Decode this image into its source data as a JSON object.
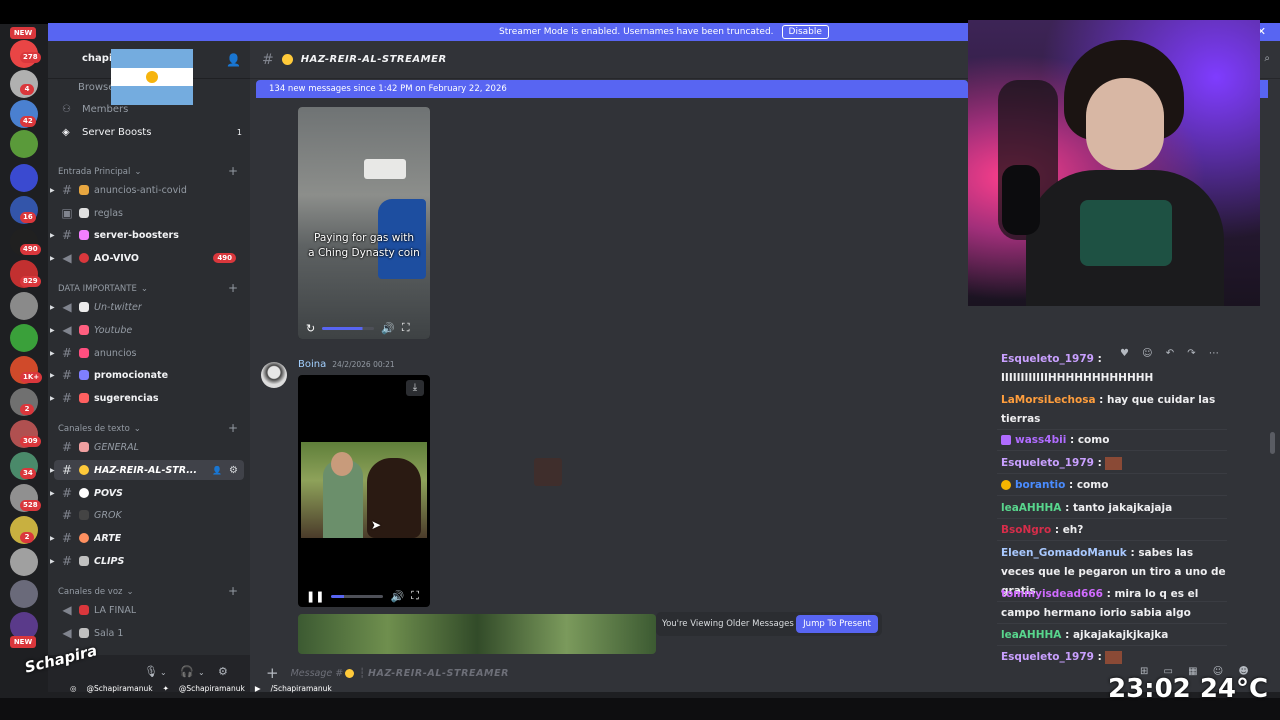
{
  "streamer_banner": {
    "text": "Streamer Mode is enabled. Usernames have been truncated.",
    "disable_label": "Disable",
    "close_label": "✕"
  },
  "server_rail": {
    "new_top": "NEW",
    "new_bottom": "NEW",
    "badges": [
      "278",
      "4",
      "42",
      "16",
      "490",
      "829",
      "1K+",
      "2",
      "309",
      "34",
      "528",
      "2"
    ]
  },
  "server": {
    "name": "chapi",
    "menu": [
      {
        "label": "Browse",
        "count": ""
      },
      {
        "label": "Members",
        "count": ""
      },
      {
        "label": "Server Boosts",
        "count": "1"
      }
    ]
  },
  "categories": [
    {
      "label": "Entrada Principal"
    },
    {
      "label": "DATA IMPORTANTE"
    },
    {
      "label": "Canales de texto"
    },
    {
      "label": "Canales de voz"
    }
  ],
  "channels": [
    {
      "label": "anuncios-anti-covid",
      "badge": ""
    },
    {
      "label": "reglas",
      "badge": ""
    },
    {
      "label": "server-boosters",
      "badge": ""
    },
    {
      "label": "AO-VIVO",
      "badge": "490"
    },
    {
      "label": "Un-twitter",
      "badge": ""
    },
    {
      "label": "Youtube",
      "badge": ""
    },
    {
      "label": "anuncios",
      "badge": ""
    },
    {
      "label": "promocionate",
      "badge": ""
    },
    {
      "label": "sugerencias",
      "badge": ""
    },
    {
      "label": "GENERAL",
      "badge": ""
    },
    {
      "label": "HAZ-REIR-AL-STR...",
      "badge": ""
    },
    {
      "label": "POVS",
      "badge": ""
    },
    {
      "label": "GROK",
      "badge": ""
    },
    {
      "label": "ARTE",
      "badge": ""
    },
    {
      "label": "CLIPS",
      "badge": ""
    },
    {
      "label": "LA FINAL",
      "badge": ""
    },
    {
      "label": "Sala 1",
      "badge": ""
    }
  ],
  "channel_header": {
    "title": "HAZ-REIR-AL-STREAMER"
  },
  "new_messages_bar": "134 new messages since 1:42 PM on February 22, 2026",
  "video1": {
    "caption_line1": "Paying for gas with",
    "caption_line2": "a Ching Dynasty coin",
    "progress": 0.78
  },
  "message": {
    "author": "Boina",
    "date": "24/2/2026 00:21"
  },
  "video2": {
    "progress": 0.25
  },
  "older_messages": {
    "text": "You're Viewing Older Messages",
    "button": "Jump To Present"
  },
  "message_input": {
    "prefix": "Message #",
    "channel": "HAZ-REIR-AL-STREAMER"
  },
  "chat": [
    {
      "user": "Esqueleto_1979",
      "text": "IIIIIIIIIIIIHHHHHHHHHHHH",
      "color": "#c9a0ff"
    },
    {
      "user": "LaMorsiLechosa",
      "text": "hay que cuidar las tierras",
      "color": "#ff9e3d"
    },
    {
      "user": "wass4bii",
      "text": "como",
      "color": "#b06cff"
    },
    {
      "user": "Esqueleto_1979",
      "text": "",
      "color": "#c9a0ff"
    },
    {
      "user": "borantio",
      "text": "como",
      "color": "#4a8cff"
    },
    {
      "user": "leaAHHHA",
      "text": "tanto jakajkajaja",
      "color": "#58d68d"
    },
    {
      "user": "BsoNgro",
      "text": "eh?",
      "color": "#d62d4a"
    },
    {
      "user": "Eleen_GomadoManuk",
      "text": "sabes las veces que le pegaron un tiro a uno de gratis",
      "color": "#a9c9ff"
    },
    {
      "user": "tommyisdead666",
      "text": "mira lo q es el campo hermano iorio sabia algo",
      "color": "#d06bff"
    },
    {
      "user": "leaAHHHA",
      "text": "ajkajakajkjkajka",
      "color": "#58d68d"
    },
    {
      "user": "Esqueleto_1979",
      "text": "",
      "color": "#c9a0ff"
    }
  ],
  "overlay": {
    "clock": "23:02",
    "temp": "24°C",
    "socials": [
      "@Schapiramanuk",
      "@Schapiramanuk",
      "/Schapiramanuk"
    ],
    "logo": "Schapira"
  }
}
